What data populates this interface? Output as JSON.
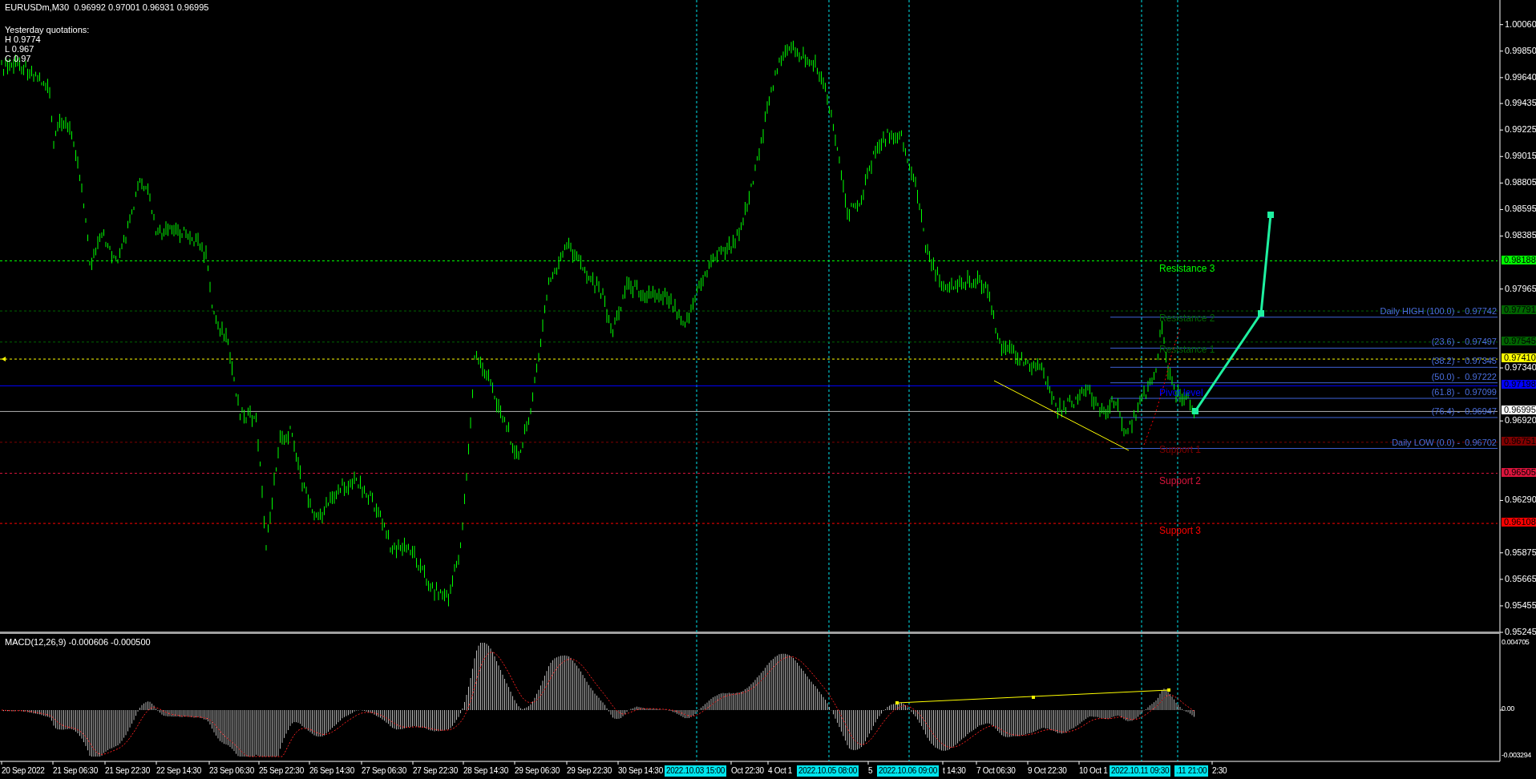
{
  "header": {
    "symbol_line": "EURUSDm,M30  0.96992 0.97001 0.96931 0.96995",
    "quotes_title": "Yesterday quotations:",
    "quotes": [
      "H 0.9774",
      "L 0.967",
      "C 0.97"
    ]
  },
  "price_axis": {
    "ticks": [
      "1.00060",
      "0.99850",
      "0.99640",
      "0.99435",
      "0.99225",
      "0.99015",
      "0.98805",
      "0.98595",
      "0.98385",
      "0.97965",
      "0.97340",
      "0.96920",
      "0.96290",
      "0.95875",
      "0.95665",
      "0.95455",
      "0.95245"
    ]
  },
  "levels": [
    {
      "tag": "0.98188",
      "label": "Resistance 3",
      "color": "#00ff00",
      "kind": "dashed"
    },
    {
      "tag": "0.97791",
      "label": "Resistance 2",
      "color": "#006400",
      "kind": "dashed"
    },
    {
      "tag": "0.97545",
      "label": "Resistance 1",
      "color": "#006400",
      "kind": "dashed"
    },
    {
      "tag": "0.97410",
      "color": "#ffff00",
      "kind": "dashed"
    },
    {
      "tag": "0.97198",
      "label": "Pivot level",
      "color": "#0000ff",
      "kind": "solid"
    },
    {
      "tag": "0.96995",
      "color": "#ffffff",
      "kind": "solid"
    },
    {
      "tag": "0.96751",
      "label": "Support 1",
      "color": "#800000",
      "kind": "dashed"
    },
    {
      "tag": "0.96505",
      "label": "Support 2",
      "color": "#dc143c",
      "kind": "dashed"
    },
    {
      "tag": "0.96108",
      "label": "Support 3",
      "color": "#ff0000",
      "kind": "dashed"
    }
  ],
  "fibonacci": [
    "Daily HIGH (100.0) -  0.97742",
    "(23.6) -  0.97497",
    "(38.2) -  0.97345",
    "(50.0) -  0.97222",
    "(61.8) -  0.97099",
    "(76.4) -  0.96947",
    "Daily LOW (0.0) -  0.96702"
  ],
  "macd": {
    "title": "MACD(12,26,9) -0.000606 -0.000500",
    "ticks": [
      "0.004705",
      "0.00",
      "-0.003294"
    ]
  },
  "time_axis": [
    {
      "text": "20 Sep 2022",
      "kind": "date"
    },
    {
      "text": "21 Sep 06:30",
      "kind": "date"
    },
    {
      "text": "21 Sep 22:30",
      "kind": "date"
    },
    {
      "text": "22 Sep 14:30",
      "kind": "date"
    },
    {
      "text": "23 Sep 06:30",
      "kind": "date"
    },
    {
      "text": "25 Sep 22:30",
      "kind": "date"
    },
    {
      "text": "26 Sep 14:30",
      "kind": "date"
    },
    {
      "text": "27 Sep 06:30",
      "kind": "date"
    },
    {
      "text": "27 Sep 22:30",
      "kind": "date"
    },
    {
      "text": "28 Sep 14:30",
      "kind": "date"
    },
    {
      "text": "29 Sep 06:30",
      "kind": "date"
    },
    {
      "text": "29 Sep 22:30",
      "kind": "date"
    },
    {
      "text": "30 Sep 14:30",
      "kind": "date"
    },
    {
      "text": "2022.10.03 15:00",
      "kind": "marker"
    },
    {
      "text": "Oct 22:30",
      "kind": "date"
    },
    {
      "text": "4 Oct 1",
      "kind": "date"
    },
    {
      "text": "2022.10.05 08:00",
      "kind": "marker"
    },
    {
      "text": "5",
      "kind": "date"
    },
    {
      "text": "2022.10.06 09:00",
      "kind": "marker"
    },
    {
      "text": "t 14:30",
      "kind": "date"
    },
    {
      "text": "7 Oct 06:30",
      "kind": "date"
    },
    {
      "text": "9 Oct 22:30",
      "kind": "date"
    },
    {
      "text": "10 Oct 1",
      "kind": "date"
    },
    {
      "text": "2022.10.11 09:30",
      "kind": "marker"
    },
    {
      "text": ".11 21:00",
      "kind": "marker"
    },
    {
      "text": "2:30",
      "kind": "date"
    }
  ]
}
